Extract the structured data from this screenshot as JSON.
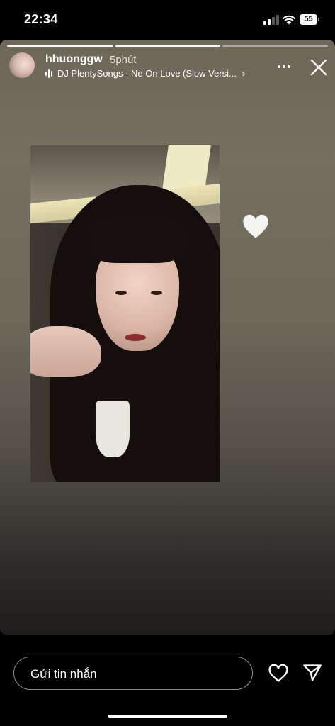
{
  "status_bar": {
    "time": "22:34",
    "battery": "55"
  },
  "story": {
    "username": "hhuonggw",
    "time_ago": "5phút",
    "music": "DJ PlentySongs · Ne On Love (Slow Versi...",
    "segments": 3,
    "current_segment": 3
  },
  "reply": {
    "placeholder": "Gửi tin nhắn"
  },
  "icons": {
    "signal": "signal-icon",
    "wifi": "wifi-icon",
    "battery": "battery-icon",
    "music": "music-bars-icon",
    "more": "more-dots-icon",
    "close": "close-icon",
    "heart_sticker": "heart-sticker-icon",
    "like": "heart-icon",
    "send": "send-icon"
  },
  "colors": {
    "background": "#000000",
    "story_top": "#6c6756",
    "story_bottom": "#1d1c1a",
    "text": "#ffffff"
  }
}
